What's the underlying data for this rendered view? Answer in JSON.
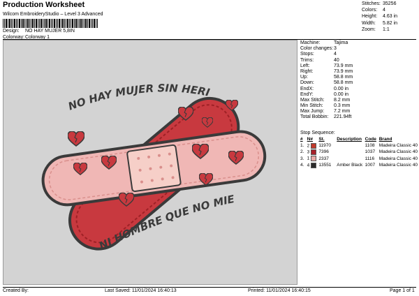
{
  "header": {
    "title": "Production Worksheet",
    "subtitle": "Wilcom EmbroideryStudio – Level 3 Advanced",
    "design_label": "Design:",
    "design_value": "NO HAY MUJER 5,8IN",
    "colorway_label": "Colorway:",
    "colorway_value": "Colorway 1"
  },
  "summary": [
    {
      "label": "Stitches:",
      "value": "35256"
    },
    {
      "label": "Colors:",
      "value": "4"
    },
    {
      "label": "Height:",
      "value": "4.63 in"
    },
    {
      "label": "Width:",
      "value": "5.82 in"
    },
    {
      "label": "Zoom:",
      "value": "1:1"
    }
  ],
  "properties": [
    {
      "label": "Machine:",
      "value": "Tajima"
    },
    {
      "label": "Color changes:",
      "value": "3"
    },
    {
      "label": "Stops:",
      "value": "4"
    },
    {
      "label": "Trims:",
      "value": "40"
    },
    {
      "label": "Left:",
      "value": "73.9 mm"
    },
    {
      "label": "Right:",
      "value": "73.9 mm"
    },
    {
      "label": "Up:",
      "value": "58.8 mm"
    },
    {
      "label": "Down:",
      "value": "58.8 mm"
    },
    {
      "label": "EndX:",
      "value": "0.00 in"
    },
    {
      "label": "EndY:",
      "value": "0.00 in"
    },
    {
      "label": "Max Stitch:",
      "value": "8.2 mm"
    },
    {
      "label": "Min Stitch:",
      "value": "0.3 mm"
    },
    {
      "label": "Max Jump:",
      "value": "7.2 mm"
    },
    {
      "label": "Total Bobbin:",
      "value": "221.94ft"
    }
  ],
  "stop_sequence": {
    "title": "Stop Sequence:",
    "headers": [
      "#",
      "N#",
      "St.",
      "Description",
      "Code",
      "Brand"
    ],
    "rows": [
      {
        "num": "1.",
        "needle": "2",
        "color": "#c0392b",
        "stitches": "11970",
        "description": "",
        "code": "1108",
        "brand": "Madeira Classic 40"
      },
      {
        "num": "2.",
        "needle": "3",
        "color": "#a8202a",
        "stitches": "7396",
        "description": "",
        "code": "1037",
        "brand": "Madeira Classic 40"
      },
      {
        "num": "3.",
        "needle": "1",
        "color": "#e9a9a6",
        "stitches": "2337",
        "description": "",
        "code": "1116",
        "brand": "Madeira Classic 40"
      },
      {
        "num": "4.",
        "needle": "4",
        "color": "#2b2b2b",
        "stitches": "13551",
        "description": "Amber Black",
        "code": "1007",
        "brand": "Madeira Classic 40"
      }
    ]
  },
  "design": {
    "text_top": "NO HAY MUJER SIN HERIDA",
    "text_bottom": "NI HOMBRE QUE NO MIENTA",
    "colors": {
      "red": "#c8393f",
      "dark_red": "#9e2126",
      "pink": "#f0b7b5",
      "light_pink": "#f6cfc8",
      "outline": "#3a3a3a"
    }
  },
  "footer": {
    "created_by_label": "Created By:",
    "last_saved_label": "Last Saved:",
    "last_saved_value": "11/01/2024 16:40:13",
    "printed_label": "Printed:",
    "printed_value": "11/01/2024 16:40:15",
    "page": "Page 1 of 1"
  }
}
